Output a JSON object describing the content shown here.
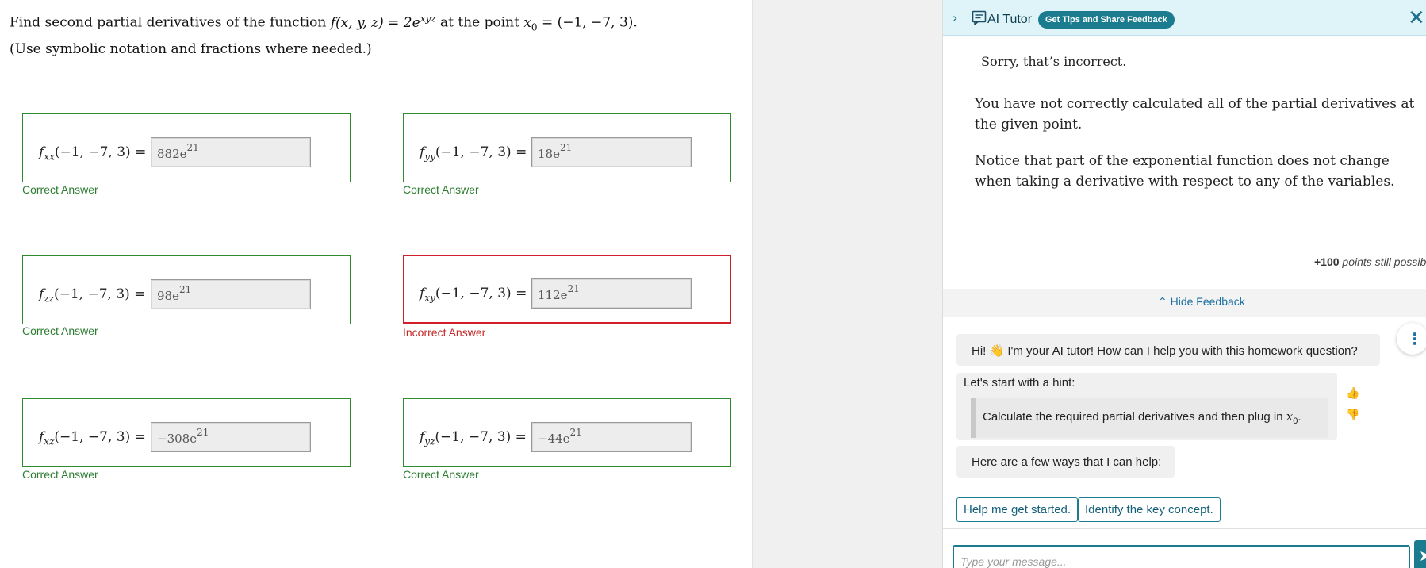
{
  "question": {
    "prompt_prefix": "Find second partial derivatives of the function ",
    "function_expr": "f(x, y, z) = 2e",
    "function_exp": "xyz",
    "prompt_mid": " at the point ",
    "point_expr": "x",
    "point_sub": "0",
    "point_value": " = (−1, −7, 3).",
    "note": "(Use symbolic notation and fractions where needed.)"
  },
  "answers": [
    {
      "sub": "xx",
      "label_rest": "(−1, −7, 3) =",
      "value_base": "882e",
      "value_exp": "21",
      "status": "Correct Answer",
      "correct": true
    },
    {
      "sub": "yy",
      "label_rest": "(−1, −7, 3) =",
      "value_base": "18e",
      "value_exp": "21",
      "status": "Correct Answer",
      "correct": true
    },
    {
      "sub": "zz",
      "label_rest": "(−1, −7, 3) =",
      "value_base": "98e",
      "value_exp": "21",
      "status": "Correct Answer",
      "correct": true
    },
    {
      "sub": "xy",
      "label_rest": "(−1, −7, 3) =",
      "value_base": "112e",
      "value_exp": "21",
      "status": "Incorrect Answer",
      "correct": false
    },
    {
      "sub": "xz",
      "label_rest": "(−1, −7, 3) =",
      "value_base": "−308e",
      "value_exp": "21",
      "status": "Correct Answer",
      "correct": true
    },
    {
      "sub": "yz",
      "label_rest": "(−1, −7, 3) =",
      "value_base": "−44e",
      "value_exp": "21",
      "status": "Correct Answer",
      "correct": true
    }
  ],
  "label_fn": "f",
  "tutor": {
    "chevron": "›",
    "title": "AI Tutor",
    "badge": "Get Tips and Share Feedback",
    "close": "✕",
    "feedback_sorry": "Sorry, that’s incorrect.",
    "feedback_p1": "You have not correctly calculated all of the partial derivatives at the given point.",
    "feedback_p2": "Notice that part of the exponential function does not change when taking a derivative with respect to any of the variables.",
    "points_value": "+100",
    "points_text": " points still possible",
    "hide_feedback": "⌃ Hide Feedback",
    "greeting_prefix": "Hi! ",
    "greeting_emoji": "👋",
    "greeting_suffix": " I'm your AI tutor! How can I help you with this homework question?",
    "hint_intro": "Let's start with a hint:",
    "hint_text_prefix": "Calculate the required partial derivatives and then plug in ",
    "hint_var": "x",
    "hint_sub": "0",
    "hint_suffix": ".",
    "ways_text": "Here are a few ways that I can help:",
    "help_buttons": [
      "Help me get started.",
      "Identify the key concept."
    ],
    "more_icon": "⋮",
    "thumb_up": "👍",
    "thumb_down": "👎",
    "input_placeholder": "Type your message..."
  },
  "colors": {
    "correct": "#2e8b2e",
    "incorrect": "#d01e2a",
    "accent": "#1a7c8e"
  }
}
